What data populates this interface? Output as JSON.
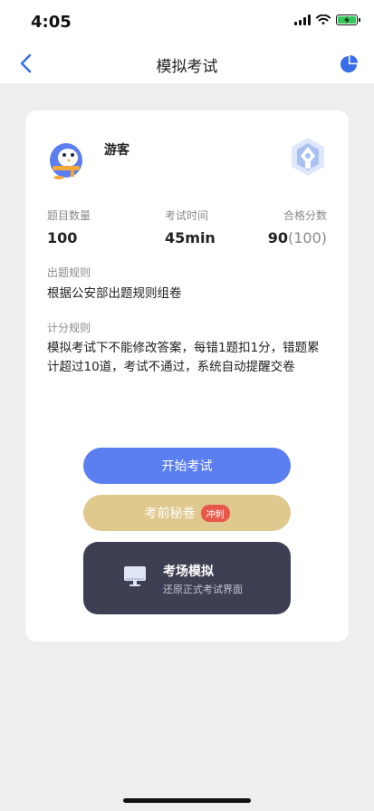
{
  "status_bar": {
    "time": "4:05"
  },
  "nav": {
    "title": "模拟考试"
  },
  "user": {
    "name": "游客"
  },
  "stats": [
    {
      "label": "题目数量",
      "value": "100",
      "sub": ""
    },
    {
      "label": "考试时间",
      "value": "45min",
      "sub": ""
    },
    {
      "label": "合格分数",
      "value": "90",
      "sub": "(100)"
    }
  ],
  "rules": {
    "question_label": "出题规则",
    "question_text": "根据公安部出题规则组卷",
    "score_label": "计分规则",
    "score_text": "模拟考试下不能修改答案，每错1题扣1分，错题累计超过10道，考试不通过，系统自动提醒交卷"
  },
  "buttons": {
    "start": "开始考试",
    "secret": "考前秘卷",
    "secret_tag": "冲刺",
    "sim_title": "考场模拟",
    "sim_sub": "还原正式考试界面"
  },
  "colors": {
    "accent": "#5b7ef0",
    "gold": "#e0c98f",
    "dark": "#3d4052",
    "tag_red": "#e8584a",
    "battery_green": "#34c759"
  },
  "icons": {
    "back": "chevron-left-icon",
    "stats": "pie-chart-icon",
    "avatar": "penguin-avatar",
    "badge": "pen-nib-badge-icon",
    "sim": "monitor-icon"
  }
}
